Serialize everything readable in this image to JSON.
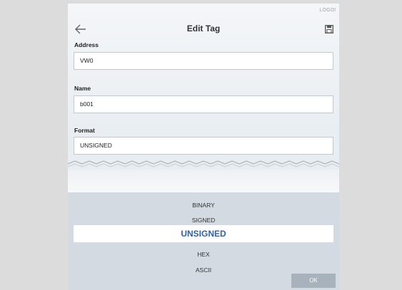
{
  "logo_text": "LOGO!",
  "header": {
    "title": "Edit Tag",
    "back_icon": "back-arrow-icon",
    "save_icon": "save-icon"
  },
  "fields": {
    "address": {
      "label": "Address",
      "value": "VW0"
    },
    "name": {
      "label": "Name",
      "value": "b001"
    },
    "format": {
      "label": "Format",
      "value": "UNSIGNED"
    }
  },
  "picker": {
    "options": [
      "BINARY",
      "SIGNED",
      "UNSIGNED",
      "HEX",
      "ASCII"
    ],
    "selected": "UNSIGNED",
    "ok_label": "OK"
  },
  "colors": {
    "accent": "#2e62a8",
    "picker_bg": "#d3dae1",
    "ok_button": "#a7b2bd"
  }
}
